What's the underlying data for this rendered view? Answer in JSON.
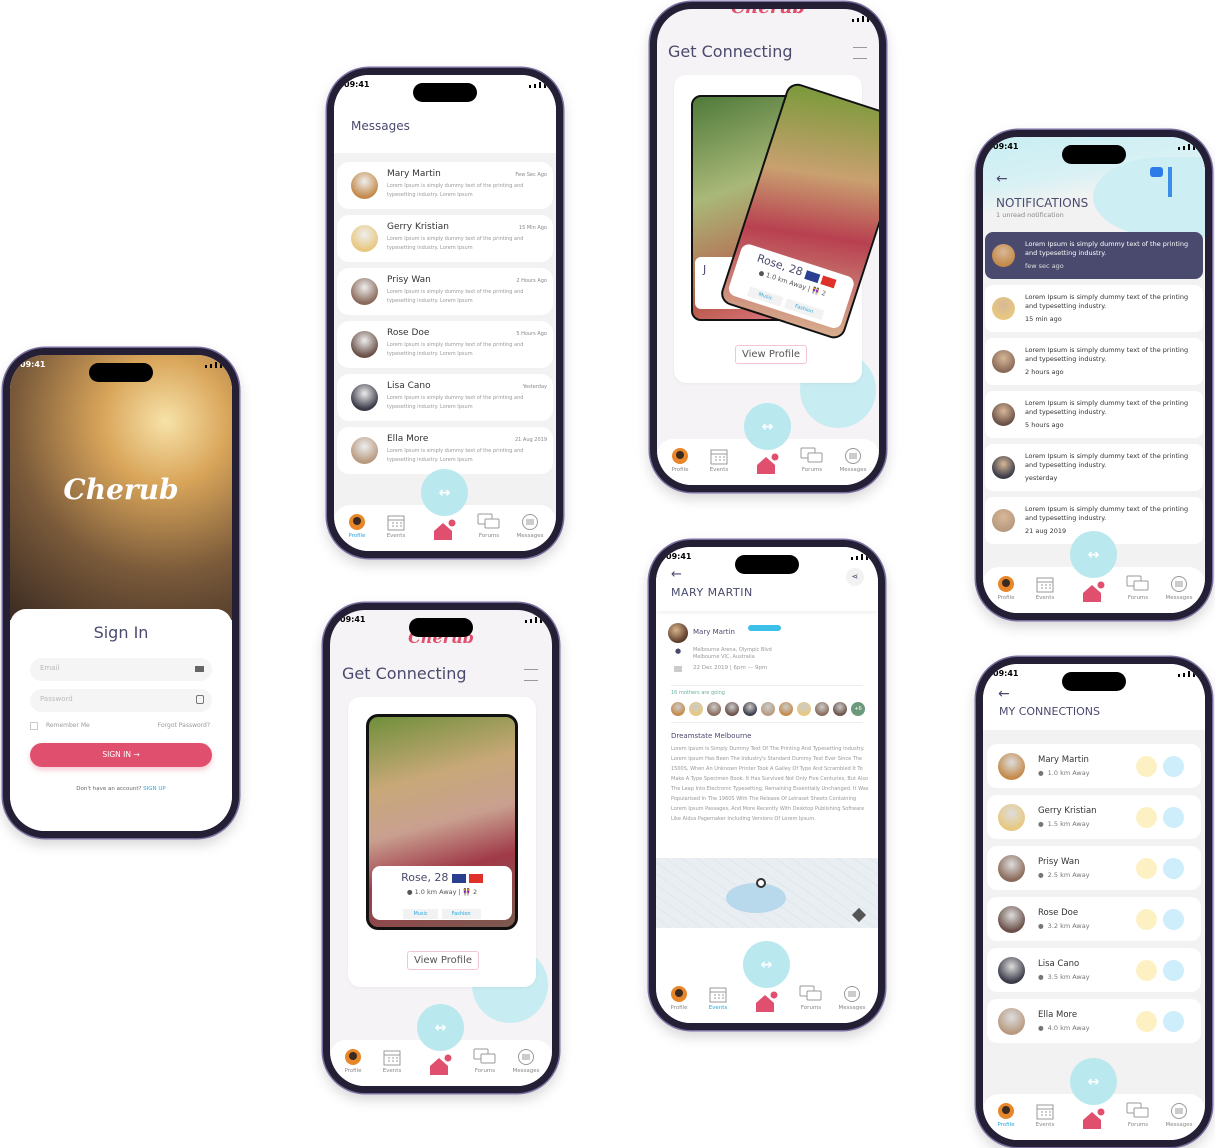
{
  "status_time": "09:41",
  "brand": "Cherub",
  "colors": {
    "primary": "#e0506e",
    "accent_cyan": "#b9e8ef",
    "dark": "#4a4a6e",
    "link": "#29a8e0",
    "like": "#fdf1c4",
    "chat": "#cdeefa"
  },
  "bottom_nav": [
    {
      "label": "Profile",
      "icon": "profile-avatar"
    },
    {
      "label": "Events",
      "icon": "calendar-icon"
    },
    {
      "label": "",
      "icon": "home-bell-icon"
    },
    {
      "label": "Forums",
      "icon": "forums-icon"
    },
    {
      "label": "Messages",
      "icon": "messages-icon"
    }
  ],
  "sign_in": {
    "title": "Sign In",
    "email_placeholder": "Email",
    "password_placeholder": "Password",
    "remember": "Remember Me",
    "forgot": "Forgot Password?",
    "button": "SIGN IN",
    "no_account": "Don't have an account?",
    "sign_up": "SIGN UP"
  },
  "messages": {
    "title": "Messages",
    "items": [
      {
        "name": "Mary Martin",
        "time": "Few Sec Ago",
        "preview": "Lorem Ipsum is simply dummy text of the printing and typesetting industry. Lorem Ipsum"
      },
      {
        "name": "Gerry Kristian",
        "time": "15 Min Ago",
        "preview": "Lorem Ipsum is simply dummy text of the printing and typesetting industry. Lorem Ipsum"
      },
      {
        "name": "Prisy Wan",
        "time": "2 Hours Ago",
        "preview": "Lorem Ipsum is simply dummy text of the printing and typesetting industry. Lorem Ipsum"
      },
      {
        "name": "Rose Doe",
        "time": "5 Hours Ago",
        "preview": "Lorem Ipsum is simply dummy text of the printing and typesetting industry. Lorem Ipsum"
      },
      {
        "name": "Lisa Cano",
        "time": "Yesterday",
        "preview": "Lorem Ipsum is simply dummy text of the printing and typesetting industry. Lorem Ipsum"
      },
      {
        "name": "Ella More",
        "time": "21 Aug 2019",
        "preview": "Lorem Ipsum is simply dummy text of the printing and typesetting industry. Lorem Ipsum"
      }
    ]
  },
  "connect": {
    "title": "Get Connecting",
    "name": "Rose, 28",
    "distance": "1.0 km Away",
    "kids": "2",
    "tags": [
      "Music",
      "Fashion"
    ],
    "view_profile": "View Profile",
    "back_card_initial": "J"
  },
  "event": {
    "title": "MARY MARTIN",
    "host": "Mary Martin",
    "address1": "Melbourne Arena, Olympic Blvd",
    "address2": "Melbourne VIC, Australia",
    "date": "22 Dec 2019 | 6pm –– 9pm",
    "going": "16 mothers are going",
    "more": "+6",
    "heading": "Dreamstate Melbourne",
    "body": "Lorem Ipsum Is Simply Dummy Text Of The Printing And Typesetting Industry. Lorem Ipsum Has Been The Industry's Standard Dummy Text Ever Since The 1500S, When An Unknown Printer Took A Galley Of Type And Scrambled It To Make A Type Specimen Book. It Has Survived Not Only Five Centuries, But Also The Leap Into Electronic Typesetting, Remaining Essentially Unchanged. It Was Popularised In The 1960S With The Release Of Letraset Sheets Containing Lorem Ipsum Passages, And More Recently With Desktop Publishing Software Like Aldus Pagemaker Including Versions Of Lorem Ipsum."
  },
  "notifications": {
    "title": "NOTIFICATIONS",
    "subtitle": "1 unread notification",
    "items": [
      {
        "text": "Lorem Ipsum is simply dummy text of the printing and typesetting industry.",
        "time": "few sec ago",
        "unread": true
      },
      {
        "text": "Lorem Ipsum is simply dummy text of the printing and typesetting industry.",
        "time": "15 min ago",
        "unread": false
      },
      {
        "text": "Lorem Ipsum is simply dummy text of the printing and typesetting industry.",
        "time": "2 hours ago",
        "unread": false
      },
      {
        "text": "Lorem Ipsum is simply dummy text of the printing and typesetting industry.",
        "time": "5 hours ago",
        "unread": false
      },
      {
        "text": "Lorem Ipsum is simply dummy text of the printing and typesetting industry.",
        "time": "yesterday",
        "unread": false
      },
      {
        "text": "Lorem Ipsum is simply dummy text of the printing and typesetting industry.",
        "time": "21 aug 2019",
        "unread": false
      }
    ]
  },
  "connections": {
    "title": "MY CONNECTIONS",
    "items": [
      {
        "name": "Mary Martin",
        "distance": "1.0 km Away"
      },
      {
        "name": "Gerry Kristian",
        "distance": "1.5 km Away"
      },
      {
        "name": "Prisy Wan",
        "distance": "2.5 km Away"
      },
      {
        "name": "Rose Doe",
        "distance": "3.2 km Away"
      },
      {
        "name": "Lisa Cano",
        "distance": "3.5 km Away"
      },
      {
        "name": "Ella More",
        "distance": "4.0 km Away"
      }
    ]
  }
}
